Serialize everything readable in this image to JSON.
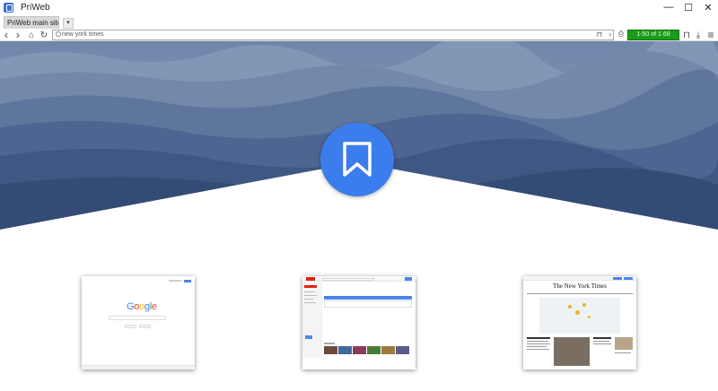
{
  "window": {
    "title": "PriWeb",
    "minimize_glyph": "—",
    "maximize_glyph": "☐",
    "close_glyph": "✕"
  },
  "tabs": [
    {
      "label": "PriWeb main site",
      "active": true
    }
  ],
  "tab_dropdown_glyph": "▾",
  "nav": {
    "back_glyph": "‹",
    "forward_glyph": "›",
    "home_glyph": "⌂",
    "reload_glyph": "↻",
    "address_value": "new york times",
    "bookmark_glyph": "⊓",
    "go_glyph": "›",
    "print_glyph": "⎙",
    "result_counter": "1-50 of 1 68",
    "bookmark_menu_glyph": "⊓",
    "download_glyph": "⤓",
    "menu_glyph": "≡"
  },
  "hero": {
    "bookmark_icon": "bookmark-icon",
    "colors": {
      "sky": "#7d93b4",
      "accent": "#3c7ded"
    }
  },
  "thumbnails": [
    {
      "name": "google",
      "logo_letters": [
        "G",
        "o",
        "o",
        "g",
        "l",
        "e"
      ],
      "logo_colors": [
        "#4285f4",
        "#ea4335",
        "#fbbc05",
        "#4285f4",
        "#34a853",
        "#ea4335"
      ]
    },
    {
      "name": "youtube"
    },
    {
      "name": "nytimes",
      "masthead": "The New York Times"
    }
  ]
}
